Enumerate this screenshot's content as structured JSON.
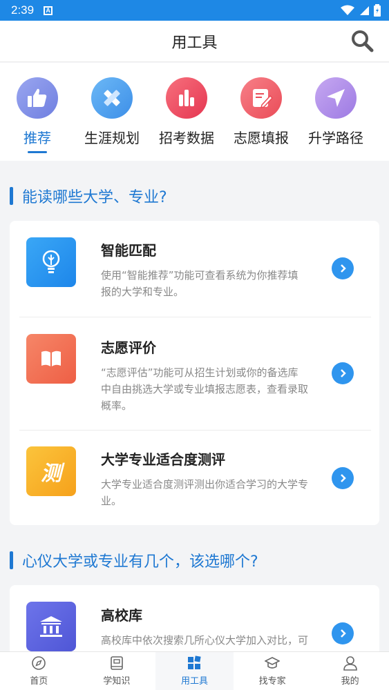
{
  "status_bar": {
    "time": "2:39",
    "notification_icon": "A"
  },
  "header": {
    "title": "用工具"
  },
  "categories": [
    {
      "label": "推荐",
      "icon": "thumbs-up-icon",
      "active": true,
      "color": "#8a96e6"
    },
    {
      "label": "生涯规划",
      "icon": "pencil-ruler-icon",
      "active": false,
      "color": "#4da3ef"
    },
    {
      "label": "招考数据",
      "icon": "bar-chart-icon",
      "active": false,
      "color": "#f04e63"
    },
    {
      "label": "志愿填报",
      "icon": "form-edit-icon",
      "active": false,
      "color": "#f4646e"
    },
    {
      "label": "升学路径",
      "icon": "navigation-arrow-icon",
      "active": false,
      "color": "#b192ea"
    }
  ],
  "section1": {
    "title": "能读哪些大学、专业?",
    "items": [
      {
        "name": "智能匹配",
        "desc": "使用“智能推荐”功能可查看系统为你推荐填报的大学和专业。",
        "color": "#2196f3"
      },
      {
        "name": "志愿评价",
        "desc": "“志愿评估”功能可从招生计划或你的备选库中自由挑选大学或专业填报志愿表，查看录取概率。",
        "color": "#f26d50"
      },
      {
        "name": "大学专业适合度测评",
        "desc": "大学专业适合度测评测出你适合学习的大学专业。",
        "color": "#f9b22a",
        "tile_text": "测"
      }
    ]
  },
  "section2": {
    "title": "心仪大学或专业有几个，该选哪个?",
    "items": [
      {
        "name": "高校库",
        "desc": "高校库中依次搜索几所心仪大学加入对比，可比较大学各项条件差异。",
        "color": "#5b63e0"
      }
    ]
  },
  "bottom_nav": [
    {
      "label": "首页",
      "icon": "compass-icon",
      "active": false
    },
    {
      "label": "学知识",
      "icon": "book-icon",
      "active": false
    },
    {
      "label": "用工具",
      "icon": "grid-tools-icon",
      "active": true
    },
    {
      "label": "找专家",
      "icon": "graduation-cap-icon",
      "active": false
    },
    {
      "label": "我的",
      "icon": "user-icon",
      "active": false
    }
  ],
  "colors": {
    "status_bar": "#1e88e5",
    "accent": "#1e78d2",
    "arrow": "#2f95ee"
  }
}
